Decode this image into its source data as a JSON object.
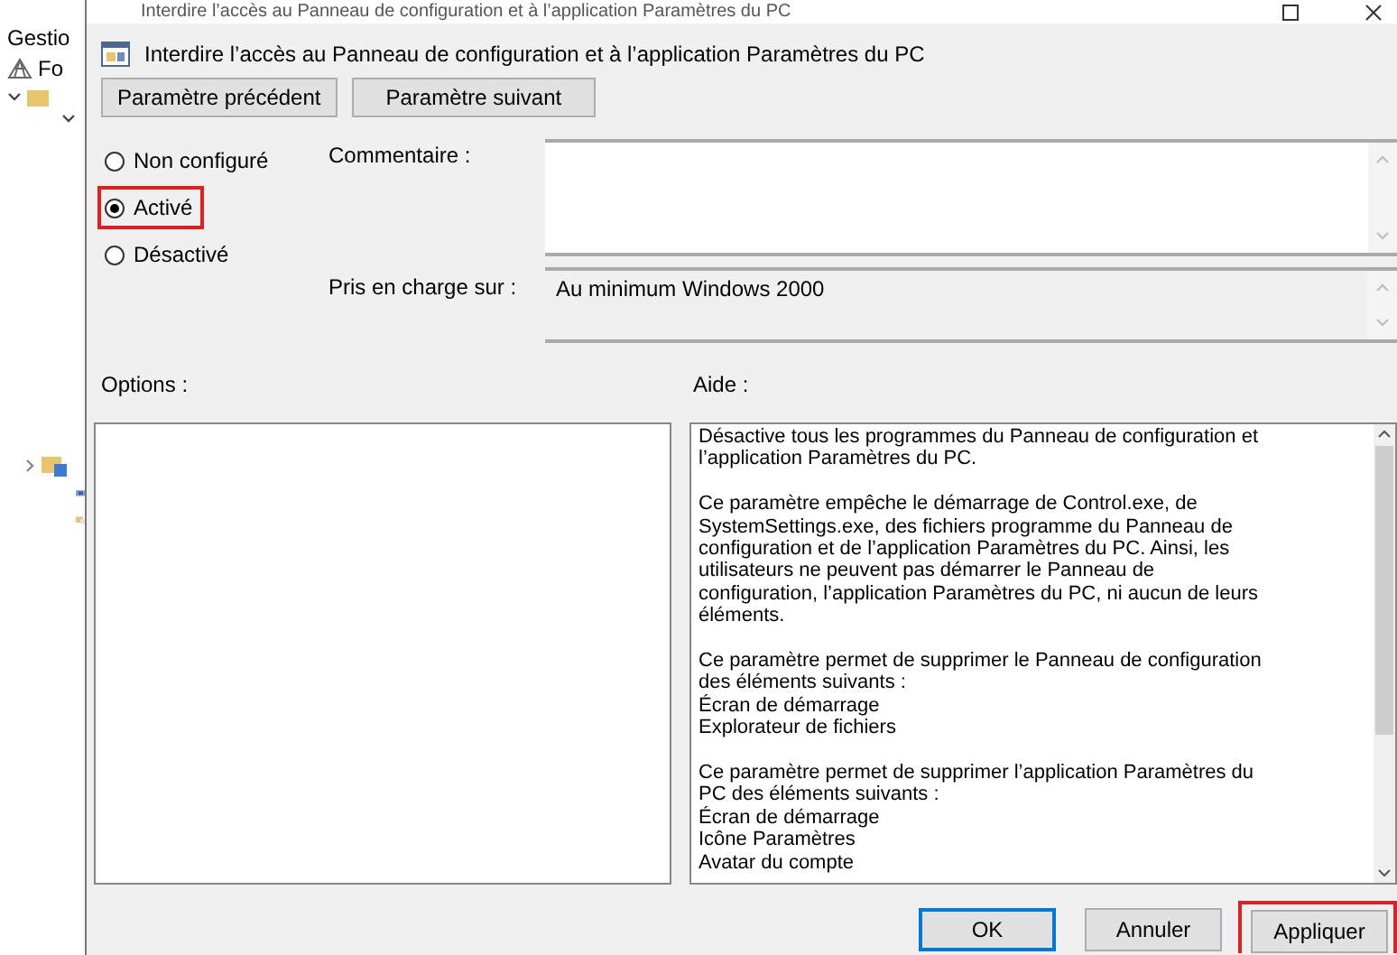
{
  "background_pane": {
    "items": [
      {
        "label": "Gestio"
      },
      {
        "label": "Fo"
      }
    ]
  },
  "window": {
    "title": "Interdire l’accès au Panneau de configuration et à l’application Paramètres du PC"
  },
  "policy": {
    "title": "Interdire l’accès au Panneau de configuration et à l’application Paramètres du PC"
  },
  "nav_buttons": [
    "Paramètre précédent",
    "Paramètre suivant"
  ],
  "states": [
    {
      "label": "Non configuré",
      "selected": false,
      "highlighted": false
    },
    {
      "label": "Activé",
      "selected": true,
      "highlighted": true
    },
    {
      "label": "Désactivé",
      "selected": false,
      "highlighted": false
    }
  ],
  "comment": {
    "label": "Commentaire :"
  },
  "supported_on": {
    "label": "Pris en charge sur :",
    "value": "Au minimum Windows 2000"
  },
  "options": {
    "label": "Options :"
  },
  "help": {
    "label": "Aide :",
    "paragraphs": [
      [
        "Désactive tous les programmes du Panneau de configuration et",
        "l’application Paramètres du PC."
      ],
      [
        "Ce paramètre empêche le démarrage de Control.exe, de",
        "SystemSettings.exe, des fichiers programme du Panneau de",
        "configuration et de l’application Paramètres du PC. Ainsi, les",
        "utilisateurs ne peuvent pas démarrer le Panneau de",
        "configuration, l’application Paramètres du PC, ni aucun de leurs",
        "éléments."
      ],
      [
        "Ce paramètre permet de supprimer le Panneau de configuration",
        "des éléments suivants :",
        "Écran de démarrage",
        "Explorateur de fichiers"
      ],
      [
        "Ce paramètre permet de supprimer l’application Paramètres du",
        "PC des éléments suivants :",
        "Écran de démarrage",
        "Icône Paramètres",
        "Avatar du compte"
      ]
    ]
  },
  "buttons": [
    {
      "label": "OK",
      "default": true,
      "highlighted": false
    },
    {
      "label": "Annuler",
      "default": false,
      "highlighted": false
    },
    {
      "label": "Appliquer",
      "default": false,
      "highlighted": true
    }
  ]
}
